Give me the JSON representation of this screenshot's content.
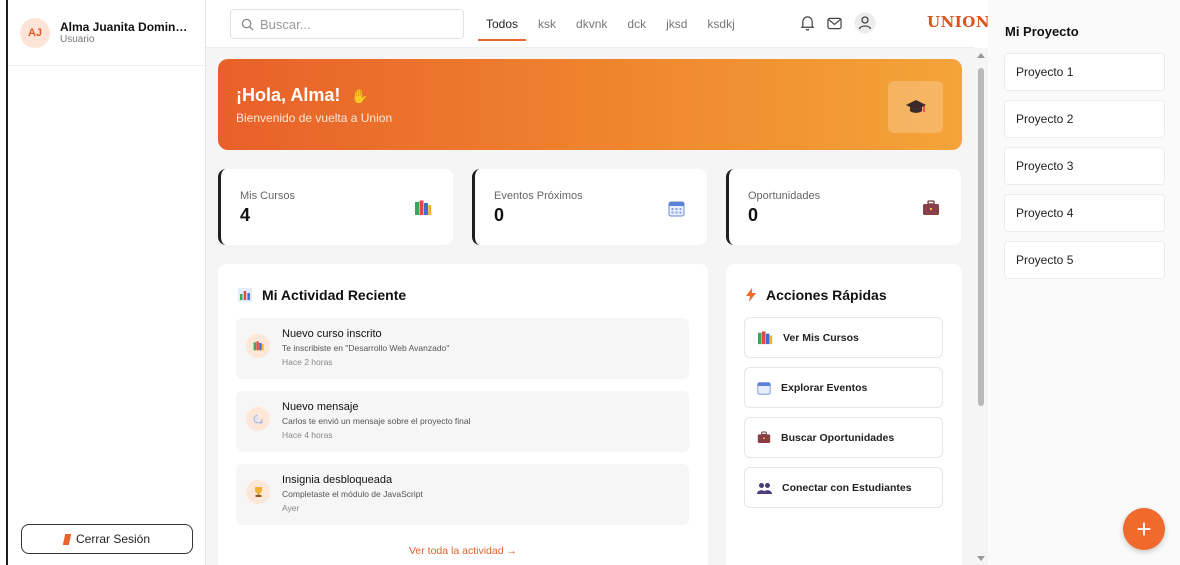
{
  "user": {
    "initials": "AJ",
    "name": "Alma Juanita Doming...",
    "role": "Usuario"
  },
  "sidebar": {
    "logout_label": "Cerrar Sesión"
  },
  "header": {
    "search_placeholder": "Buscar...",
    "tabs": [
      "Todos",
      "ksk",
      "dkvnk",
      "dck",
      "jksd",
      "ksdkj"
    ],
    "brand": "UNION"
  },
  "hero": {
    "title": "¡Hola, Alma!",
    "subtitle": "Bienvenido de vuelta a Union"
  },
  "stats": [
    {
      "label": "Mis Cursos",
      "value": "4",
      "icon": "books-icon"
    },
    {
      "label": "Eventos Próximos",
      "value": "0",
      "icon": "calendar-icon"
    },
    {
      "label": "Oportunidades",
      "value": "0",
      "icon": "briefcase-icon"
    }
  ],
  "activity": {
    "title": "Mi Actividad Reciente",
    "items": [
      {
        "title": "Nuevo curso inscrito",
        "desc": "Te inscribiste en \"Desarrollo Web Avanzado\"",
        "time": "Hace 2 horas",
        "icon": "books-icon"
      },
      {
        "title": "Nuevo mensaje",
        "desc": "Carlos te envió un mensaje sobre el proyecto final",
        "time": "Hace 4 horas",
        "icon": "message-icon"
      },
      {
        "title": "Insignia desbloqueada",
        "desc": "Completaste el módulo de JavaScript",
        "time": "Ayer",
        "icon": "trophy-icon"
      }
    ],
    "see_all": "Ver toda la actividad →"
  },
  "quick_actions": {
    "title": "Acciones Rápidas",
    "items": [
      "Ver Mis Cursos",
      "Explorar Eventos",
      "Buscar Oportunidades",
      "Conectar con Estudiantes"
    ]
  },
  "projects": {
    "title": "Mi Proyecto",
    "items": [
      "Proyecto 1",
      "Proyecto 2",
      "Proyecto 3",
      "Proyecto 4",
      "Proyecto 5"
    ],
    "add_label": "+"
  },
  "colors": {
    "accent": "#e8662e",
    "brand": "#d9541e"
  }
}
